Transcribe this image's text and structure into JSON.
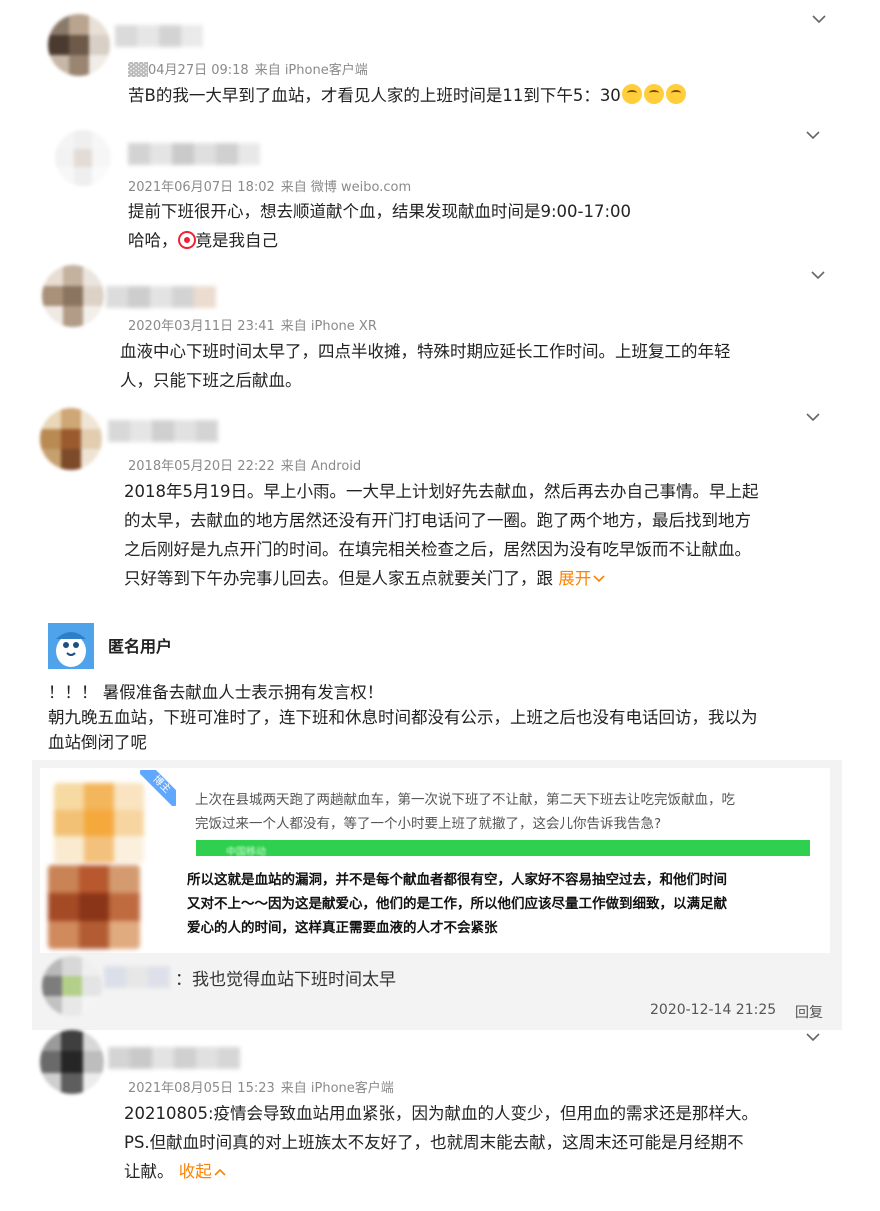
{
  "comments": [
    {
      "meta_date": "04月27日 09:18",
      "meta_source": "来自 iPhone客户端",
      "text": "苦B的我一大早到了血站，才看见人家的上班时间是11到下午5：30"
    },
    {
      "meta_date": "2021年06月07日 18:02",
      "meta_source": "来自 微博 weibo.com",
      "text_line1": "提前下班很开心，想去顺道献个血，结果发现献血时间是9:00-17:00",
      "text_line2_a": "哈哈，",
      "text_line2_b": "竟是我自己"
    },
    {
      "meta_date": "2020年03月11日 23:41",
      "meta_source": "来自 iPhone XR",
      "text_line1": "血液中心下班时间太早了，四点半收摊，特殊时期应延长工作时间。上班复工的年轻",
      "text_line2": "人，只能下班之后献血。"
    },
    {
      "meta_date": "2018年05月20日 22:22",
      "meta_source": "来自 Android",
      "text_line1": "2018年5月19日。早上小雨。一大早上计划好先去献血，然后再去办自己事情。早上起",
      "text_line2": "的太早，去献血的地方居然还没有开门打电话问了一圈。跑了两个地方，最后找到地方",
      "text_line3": "之后刚好是九点开门的时间。在填完相关检查之后，居然因为没有吃早饭而不让献血。",
      "text_line4": "只好等到下午办完事儿回去。但是人家五点就要关门了，跟",
      "expand_label": "展开"
    }
  ],
  "anonymous": {
    "username": "匿名用户",
    "line1": "！！！ 暑假准备去献血人士表示拥有发言权！",
    "line2": "朝九晚五血站，下班可准时了，连下班和休息时间都没有公示，上班之后也没有电话回访，我以为",
    "line3": "血站倒闭了呢"
  },
  "nested": {
    "badge": "博主",
    "quote_line1": "上次在县城两天跑了两趟献血车，第一次说下班了不让献，第二天下班去让吃完饭献血，吃",
    "quote_line2": "完饭过来一个人都没有，等了一个小时要上班了就撤了，这会儿你告诉我告急?",
    "green_bar_text": "中国移动",
    "bold_line1": "所以这就是血站的漏洞，并不是每个献血者都很有空，人家好不容易抽空过去，和他们时间",
    "bold_line2": "又对不上～～因为这是献爱心，他们的是工作，所以他们应该尽量工作做到细致，以满足献",
    "bold_line3": "爱心的人的时间，这样真正需要血液的人才不会紧张",
    "reply_text": "：我也觉得血站下班时间太早",
    "reply_time": "2020-12-14 21:25",
    "reply_label": "回复"
  },
  "last_comment": {
    "meta_date": "2021年08月05日 15:23",
    "meta_source": "来自 iPhone客户端",
    "text_line1": "20210805:疫情会导致血站用血紧张，因为献血的人变少，但用血的需求还是那样大。",
    "text_line2": "PS.但献血时间真的对上班族太不友好了，也就周末能去献，这周末还可能是月经期不",
    "text_line3": "让献。",
    "collapse_label": "收起"
  },
  "colors": {
    "accent": "#ff8200",
    "green_bar": "#2fcf4f",
    "meta": "#8a8a8a"
  }
}
